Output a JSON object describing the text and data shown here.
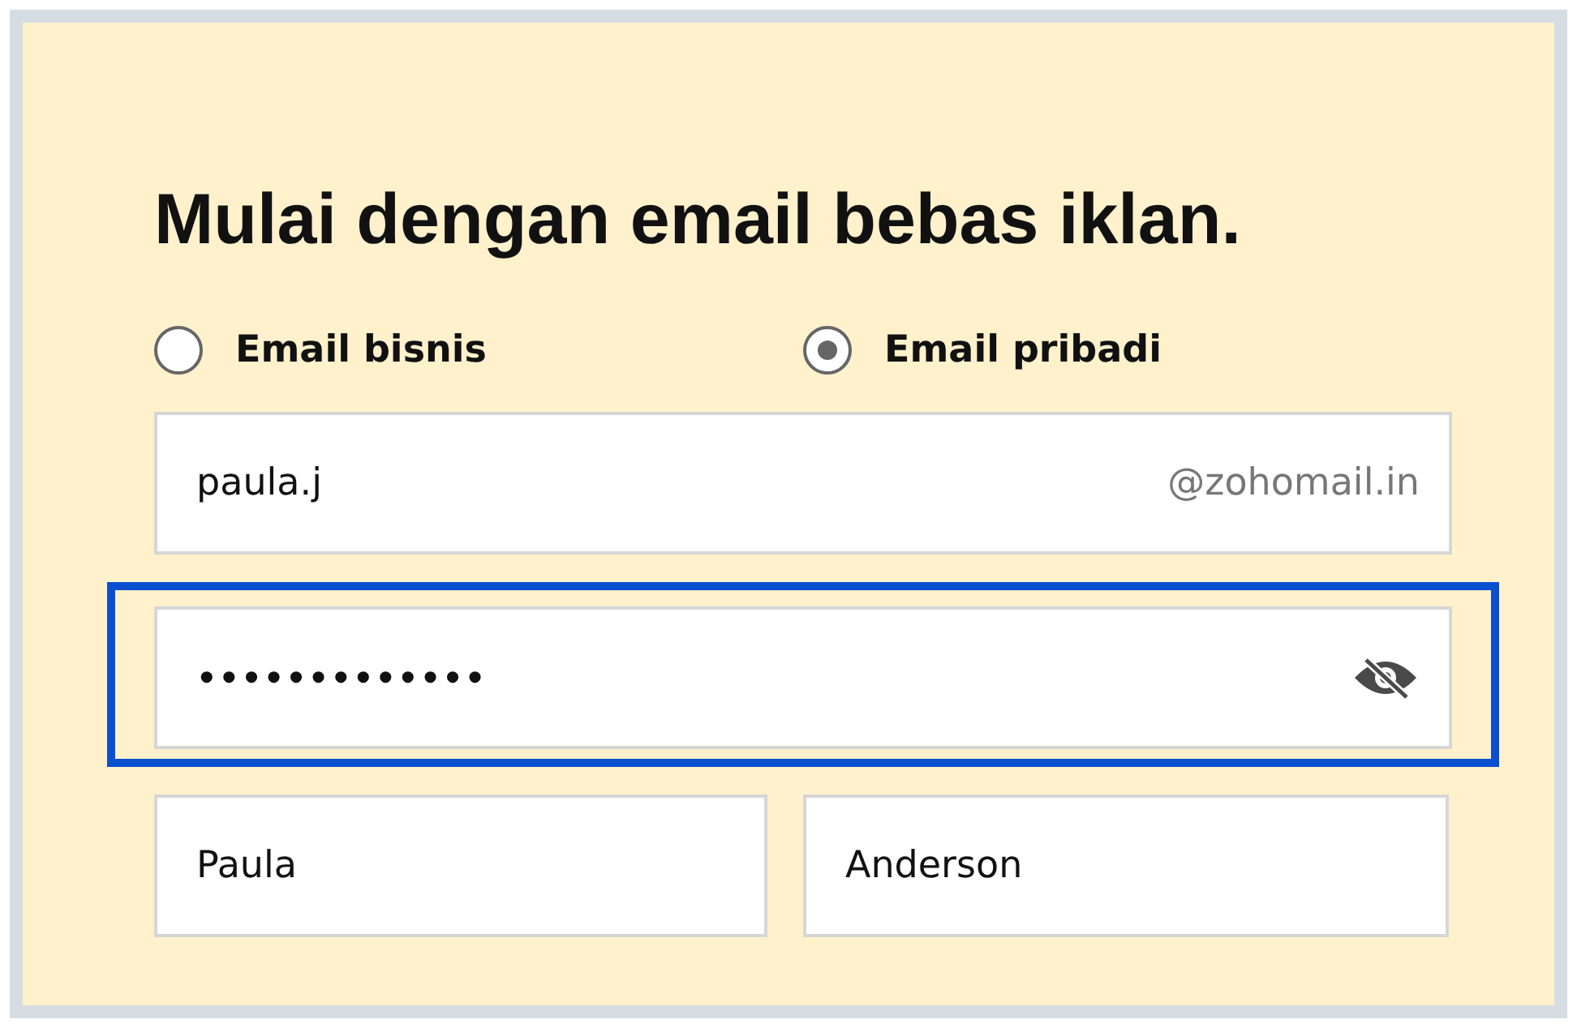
{
  "heading": "Mulai dengan email bebas iklan.",
  "account_types": [
    {
      "label": "Email bisnis",
      "selected": false
    },
    {
      "label": "Email pribadi",
      "selected": true
    }
  ],
  "email_field": {
    "value": "paula.j",
    "suffix": "@zohomail.in"
  },
  "password_field": {
    "value": "•••••••••••••",
    "highlighted": true
  },
  "first_name_field": {
    "value": "Paula"
  },
  "last_name_field": {
    "value": "Anderson"
  }
}
